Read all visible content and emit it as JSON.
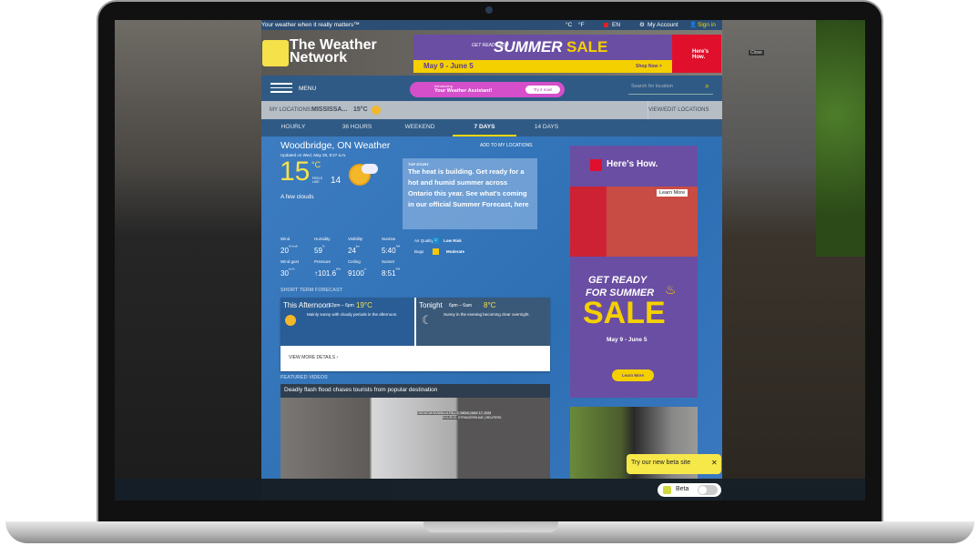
{
  "topbar": {
    "tagline": "Your weather when it really matters™",
    "unit_c": "°C",
    "unit_f": "°F",
    "lang": "EN",
    "account": "My Account",
    "signin": "Sign in"
  },
  "header": {
    "logo_line1": "The Weather",
    "logo_line2": "Network"
  },
  "top_ad": {
    "pre": "GET READY FOR",
    "title1": "SUMMER",
    "title2": "SALE",
    "dates": "May 9 - June 5",
    "shop": "Shop Now >",
    "brand": "Here's How."
  },
  "close_label": "Close",
  "nav": {
    "menu": "MENU",
    "promo_small": "Introducing",
    "promo": "Your Weather Assistant!",
    "promo_btn": "Try it now!",
    "search_placeholder": "Search for location"
  },
  "locations": {
    "label": "MY LOCATIONS:",
    "city": "MISSISSA...",
    "temp": "15°C",
    "edit": "VIEW/EDIT LOCATIONS"
  },
  "tabs": [
    {
      "label": "HOURLY"
    },
    {
      "label": "36 HOURS"
    },
    {
      "label": "WEEKEND"
    },
    {
      "label": "7 DAYS",
      "active": true
    },
    {
      "label": "14 DAYS"
    }
  ],
  "current": {
    "title": "Woodbridge, ON Weather",
    "add": "ADD TO MY LOCATIONS",
    "updated": "Updated on Wed, May 29, 9:27 a.m.",
    "temp": "15",
    "unit": "°C",
    "feels_label": "FEELS LIKE",
    "feels": "14",
    "condition": "A few clouds",
    "stats": [
      {
        "label": "Wind",
        "value": "20",
        "unit": "W km/h"
      },
      {
        "label": "Humidity",
        "value": "59",
        "unit": "%"
      },
      {
        "label": "Visibility",
        "value": "24",
        "unit": "km"
      },
      {
        "label": "Sunrise",
        "value": "5:40",
        "unit": "AM"
      },
      {
        "label": "Wind gust",
        "value": "30",
        "unit": "km/h"
      },
      {
        "label": "Pressure",
        "value": "↑101.6",
        "unit": "kPa"
      },
      {
        "label": "Ceiling",
        "value": "9100",
        "unit": "m"
      },
      {
        "label": "Sunset",
        "value": "8:51",
        "unit": "PM"
      }
    ],
    "air_label": "Air Quality",
    "air_value": "2",
    "air_text": "Low Risk",
    "bugs_label": "Bugs",
    "bugs_text": "Moderate"
  },
  "top_story": {
    "label": "TOP STORY",
    "text": "The heat is building. Get ready for a hot and humid summer across Ontario this year. See what's coming in our official Summer Forecast, here"
  },
  "short_term": {
    "heading": "SHORT TERM FORECAST",
    "periods": [
      {
        "name": "This Afternoon",
        "time": "12pm – 6pm",
        "temp": "19°C",
        "desc": "Mainly sunny with cloudy periods in the afternoon."
      },
      {
        "name": "Tonight",
        "time": "6pm – 6am",
        "temp": "8°C",
        "desc": "Sunny in the evening becoming clear overnight."
      }
    ],
    "more": "VIEW MORE DETAILS ›"
  },
  "videos": {
    "heading": "FEATURED VIDEOS",
    "title": "Deadly flash flood chases tourists from popular destination",
    "credit1": "ODDUDUKKUWALLA FALLS, INDIA | MAY 17, 2024",
    "credit2": "SOURCE: STRINGERSHUB | REUTERS"
  },
  "side_ad": {
    "brand": "Here's How.",
    "video_btn": "Learn More",
    "line1": "GET READY",
    "line2": "FOR SUMMER",
    "sale": "SALE",
    "dates": "May 9 - June 5",
    "btn": "Learn More"
  },
  "beta": {
    "tooltip": "Try our new beta site",
    "label": "Beta"
  },
  "colors": {
    "nav": "#2f5a85",
    "accent": "#f5d800",
    "ad_purple": "#6a4ea3"
  }
}
